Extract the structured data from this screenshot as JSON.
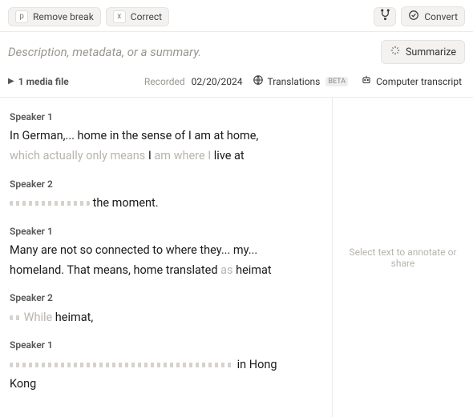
{
  "toolbar": {
    "remove_break_key": "p",
    "remove_break_label": "Remove break",
    "correct_key": "x",
    "correct_label": "Correct",
    "convert_label": "Convert"
  },
  "meta": {
    "description_placeholder": "Description, metadata, or a summary.",
    "summarize_label": "Summarize"
  },
  "subbar": {
    "media_file_label": "1 media file",
    "recorded_label": "Recorded",
    "recorded_date": "02/20/2024",
    "translations_label": "Translations",
    "beta_label": "BETA",
    "computer_transcript_label": "Computer transcript"
  },
  "sidebar": {
    "hint": "Select text to annotate or share"
  },
  "transcript": [
    {
      "speaker": "Speaker 1",
      "lines": [
        {
          "parts": [
            {
              "t": "In German,... home in the sense of I am at home,",
              "style": "seg"
            }
          ]
        },
        {
          "parts": [
            {
              "t": "which actually only means ",
              "style": "faded"
            },
            {
              "t": "I ",
              "style": "seg"
            },
            {
              "t": "am where I ",
              "style": "faded"
            },
            {
              "t": "live at",
              "style": "seg"
            }
          ]
        }
      ]
    },
    {
      "speaker": "Speaker 2",
      "lines": [
        {
          "parts": [
            {
              "wave": "w1"
            },
            {
              "t": " the moment.",
              "style": "seg"
            }
          ]
        }
      ]
    },
    {
      "speaker": "Speaker 1",
      "lines": [
        {
          "parts": [
            {
              "t": "Many are not so connected to where they... my...",
              "style": "seg"
            }
          ]
        },
        {
          "parts": [
            {
              "t": "homeland. That means, home translated ",
              "style": "seg"
            },
            {
              "t": "as ",
              "style": "faded"
            },
            {
              "t": "heimat",
              "style": "seg"
            }
          ]
        }
      ]
    },
    {
      "speaker": "Speaker 2",
      "lines": [
        {
          "parts": [
            {
              "wave": "w2"
            },
            {
              "t": " While ",
              "style": "faded"
            },
            {
              "t": "heimat,",
              "style": "seg"
            }
          ]
        }
      ]
    },
    {
      "speaker": "Speaker 1",
      "lines": [
        {
          "parts": [
            {
              "wave": "w3"
            },
            {
              "t": " in Hong",
              "style": "seg"
            }
          ]
        },
        {
          "parts": [
            {
              "t": "Kong",
              "style": "seg"
            }
          ]
        }
      ]
    }
  ]
}
